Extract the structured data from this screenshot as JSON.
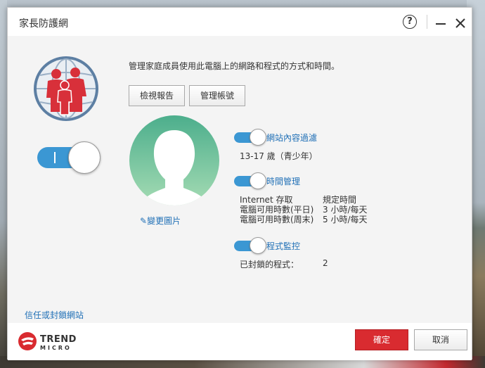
{
  "window": {
    "title": "家長防護網"
  },
  "sidebar": {
    "trust_block_link": "信任或封鎖網站",
    "master_toggle_state": "on"
  },
  "main": {
    "description": "管理家庭成員使用此電腦上的網路和程式的方式和時間。",
    "view_report_label": "檢視報告",
    "manage_account_label": "管理帳號",
    "change_photo_label": "變更圖片"
  },
  "settings": {
    "web_filter": {
      "label": "網站內容過濾",
      "value": "13-17 歲（青少年）",
      "state": "on"
    },
    "time_management": {
      "label": "時間管理",
      "state": "on",
      "rows": [
        {
          "name": "Internet 存取",
          "value": "規定時間"
        },
        {
          "name": "電腦可用時數(平日)",
          "value": "3 小時/每天"
        },
        {
          "name": "電腦可用時數(周末)",
          "value": "5 小時/每天"
        }
      ]
    },
    "program_control": {
      "label": "程式監控",
      "state": "on",
      "blocked_label": "已封鎖的程式：",
      "blocked_count": "2"
    }
  },
  "footer": {
    "brand_line1": "TREND",
    "brand_line2": "MICRO",
    "ok_label": "確定",
    "cancel_label": "取消"
  },
  "colors": {
    "accent_blue": "#3b97d3",
    "link_blue": "#1f6fb6",
    "ok_red": "#d92b30",
    "avatar_green_top": "#4cae8c",
    "avatar_green_bottom": "#a6dcb4"
  }
}
